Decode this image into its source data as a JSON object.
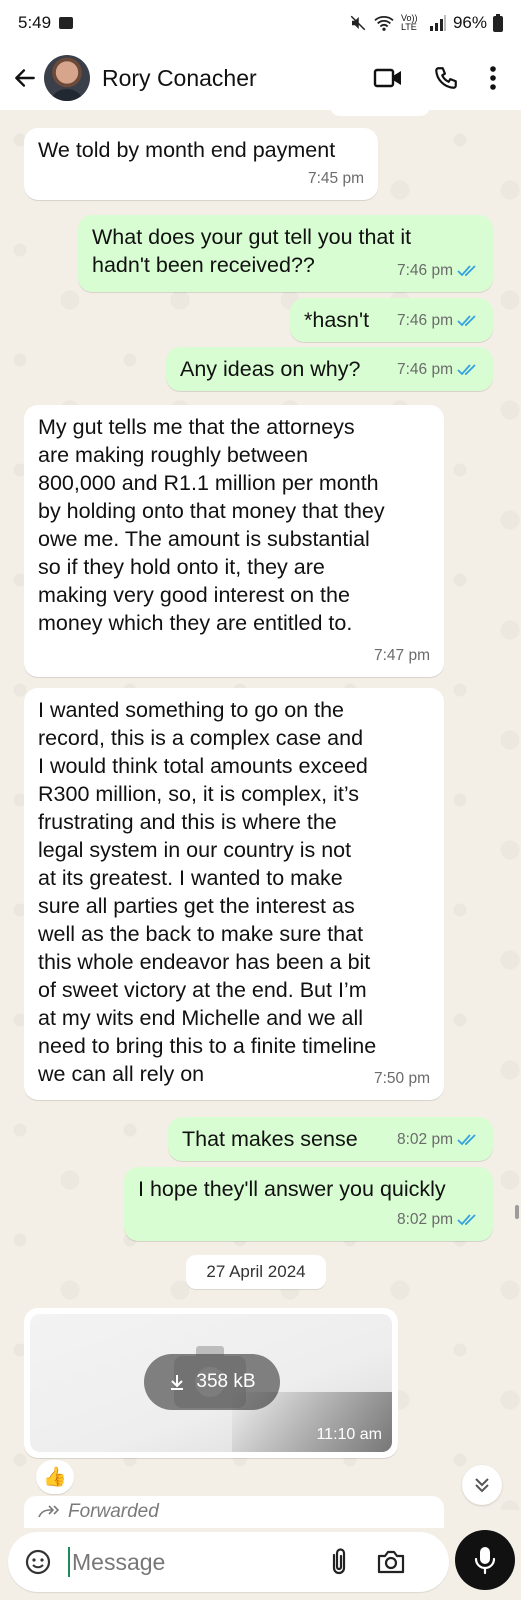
{
  "status_bar": {
    "time": "5:49",
    "battery": "96%",
    "network": "Vo)) LTE"
  },
  "header": {
    "contact_name": "Rory Conacher",
    "back_icon": "arrow-left-icon",
    "video_icon": "video-call-icon",
    "call_icon": "phone-icon",
    "menu_icon": "more-vert-icon"
  },
  "messages": [
    {
      "dir": "in",
      "lines": [
        "We told by month end payment"
      ],
      "time": "7:45 pm"
    },
    {
      "dir": "out",
      "lines": [
        "What does your gut tell you that it",
        "hadn't been received??"
      ],
      "time": "7:46 pm"
    },
    {
      "dir": "out",
      "lines": [
        "*hasn't"
      ],
      "time": "7:46 pm"
    },
    {
      "dir": "out",
      "lines": [
        "Any ideas on why?"
      ],
      "time": "7:46 pm"
    },
    {
      "dir": "in",
      "lines": [
        "My gut tells me that the attorneys",
        "are making roughly between",
        "800,000 and R1.1 million per month",
        "by holding onto that money that they",
        "owe me. The amount is substantial",
        "so if they hold onto it, they are",
        "making very good interest on the",
        "money which they are entitled to."
      ],
      "time": "7:47 pm"
    },
    {
      "dir": "in",
      "lines": [
        "I wanted something to go on the",
        "record, this is a complex case and",
        "I would think total amounts exceed",
        "R300 million, so, it is complex, it’s",
        "frustrating and this is where the",
        "legal system in our country is not",
        "at its greatest. I wanted to make",
        "sure all parties get the interest as",
        "well as the back to make sure that",
        "this whole endeavor has been a bit",
        "of sweet victory at the end. But I’m",
        "at my wits end Michelle and we all",
        "need to bring this to a finite timeline",
        "we can all rely on"
      ],
      "time": "7:50 pm"
    },
    {
      "dir": "out",
      "lines": [
        "That makes sense"
      ],
      "time": "8:02 pm"
    },
    {
      "dir": "out",
      "lines": [
        "I hope they'll answer you quickly"
      ],
      "time": "8:02 pm"
    }
  ],
  "date_separator": "27 April 2024",
  "media": {
    "size": "358 kB",
    "time": "11:10 am",
    "reaction": "👍"
  },
  "forwarded_label": "Forwarded",
  "composer": {
    "placeholder": "Message"
  },
  "colors": {
    "outgoing_bubble": "#d8fdd2",
    "incoming_bubble": "#ffffff",
    "read_tick": "#34a2e0",
    "chat_bg": "#f4efe6"
  }
}
